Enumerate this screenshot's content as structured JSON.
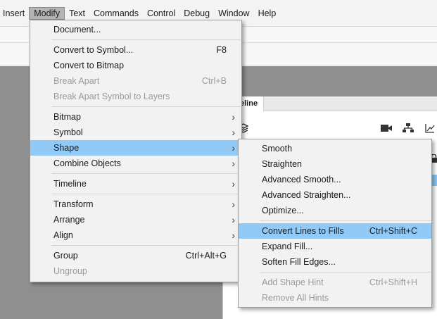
{
  "menubar": {
    "items": [
      "Insert",
      "Modify",
      "Text",
      "Commands",
      "Control",
      "Debug",
      "Window",
      "Help"
    ],
    "active": "Modify"
  },
  "timeline": {
    "tab_label": "eline"
  },
  "modify_menu": {
    "groups": [
      [
        {
          "label": "Document...",
          "shortcut": "",
          "submenu": false,
          "disabled": false
        }
      ],
      [
        {
          "label": "Convert to Symbol...",
          "shortcut": "F8",
          "submenu": false,
          "disabled": false
        },
        {
          "label": "Convert to Bitmap",
          "shortcut": "",
          "submenu": false,
          "disabled": false
        },
        {
          "label": "Break Apart",
          "shortcut": "Ctrl+B",
          "submenu": false,
          "disabled": true
        },
        {
          "label": "Break Apart Symbol to Layers",
          "shortcut": "",
          "submenu": false,
          "disabled": true
        }
      ],
      [
        {
          "label": "Bitmap",
          "shortcut": "",
          "submenu": true,
          "disabled": false
        },
        {
          "label": "Symbol",
          "shortcut": "",
          "submenu": true,
          "disabled": false
        },
        {
          "label": "Shape",
          "shortcut": "",
          "submenu": true,
          "disabled": false,
          "highlight": true
        },
        {
          "label": "Combine Objects",
          "shortcut": "",
          "submenu": true,
          "disabled": false
        }
      ],
      [
        {
          "label": "Timeline",
          "shortcut": "",
          "submenu": true,
          "disabled": false
        }
      ],
      [
        {
          "label": "Transform",
          "shortcut": "",
          "submenu": true,
          "disabled": false
        },
        {
          "label": "Arrange",
          "shortcut": "",
          "submenu": true,
          "disabled": false
        },
        {
          "label": "Align",
          "shortcut": "",
          "submenu": true,
          "disabled": false
        }
      ],
      [
        {
          "label": "Group",
          "shortcut": "Ctrl+Alt+G",
          "submenu": false,
          "disabled": false
        },
        {
          "label": "Ungroup",
          "shortcut": "",
          "submenu": false,
          "disabled": true
        }
      ]
    ]
  },
  "shape_submenu": {
    "groups": [
      [
        {
          "label": "Smooth",
          "shortcut": "",
          "disabled": false
        },
        {
          "label": "Straighten",
          "shortcut": "",
          "disabled": false
        },
        {
          "label": "Advanced Smooth...",
          "shortcut": "",
          "disabled": false
        },
        {
          "label": "Advanced Straighten...",
          "shortcut": "",
          "disabled": false
        },
        {
          "label": "Optimize...",
          "shortcut": "",
          "disabled": false
        }
      ],
      [
        {
          "label": "Convert Lines to Fills",
          "shortcut": "Ctrl+Shift+C",
          "disabled": false,
          "highlight": true
        },
        {
          "label": "Expand Fill...",
          "shortcut": "",
          "disabled": false
        },
        {
          "label": "Soften Fill Edges...",
          "shortcut": "",
          "disabled": false
        }
      ],
      [
        {
          "label": "Add Shape Hint",
          "shortcut": "Ctrl+Shift+H",
          "disabled": true
        },
        {
          "label": "Remove All Hints",
          "shortcut": "",
          "disabled": true
        }
      ]
    ]
  },
  "icons": {
    "submenu_arrow": "chevron-right-icon",
    "timeline": [
      "layers-icon",
      "camera-icon",
      "hierarchy-icon",
      "graph-icon",
      "lock-icon"
    ]
  }
}
